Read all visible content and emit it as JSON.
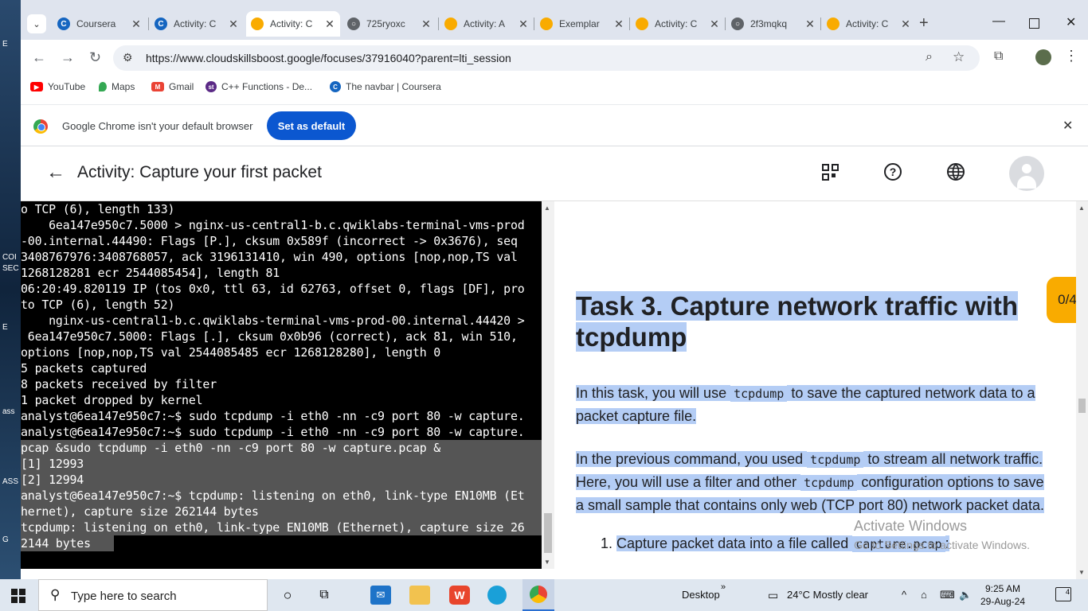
{
  "desktop": {
    "labels": [
      "E",
      "COI",
      "SEC",
      "E",
      "ass",
      "ASS",
      "G"
    ]
  },
  "tabs": [
    {
      "title": "Coursera",
      "fav": "C",
      "color": "#1565c0"
    },
    {
      "title": "Activity: C",
      "fav": "C",
      "color": "#1565c0"
    },
    {
      "title": "Activity: C",
      "fav": "",
      "color": "#f9ab00",
      "active": true
    },
    {
      "title": "725ryoxc",
      "fav": "",
      "color": "#5f6368"
    },
    {
      "title": "Activity: A",
      "fav": "",
      "color": "#f9ab00"
    },
    {
      "title": "Exemplar",
      "fav": "",
      "color": "#f9ab00"
    },
    {
      "title": "Activity: C",
      "fav": "",
      "color": "#f9ab00"
    },
    {
      "title": "2f3mqkq",
      "fav": "",
      "color": "#5f6368"
    },
    {
      "title": "Activity: C",
      "fav": "",
      "color": "#f9ab00"
    }
  ],
  "address": {
    "url": "https://www.cloudskillsboost.google/focuses/37916040?parent=lti_session"
  },
  "bookmarks": [
    {
      "label": "YouTube",
      "color": "#ff0000"
    },
    {
      "label": "Maps",
      "color": "#34a853"
    },
    {
      "label": "Gmail",
      "color": "#ea4335"
    },
    {
      "label": "C++ Functions - De...",
      "color": "#5b2a86"
    },
    {
      "label": "The navbar | Coursera",
      "color": "#1565c0"
    }
  ],
  "infobar": {
    "message": "Google Chrome isn't your default browser",
    "button": "Set as default"
  },
  "lab": {
    "title": "Activity: Capture your first packet",
    "score": "0/4"
  },
  "terminal": {
    "lines": [
      "o TCP (6), length 133)",
      "    6ea147e950c7.5000 > nginx-us-central1-b.c.qwiklabs-terminal-vms-prod",
      "-00.internal.44490: Flags [P.], cksum 0x589f (incorrect -> 0x3676), seq",
      "3408767976:3408768057, ack 3196131410, win 490, options [nop,nop,TS val",
      "1268128281 ecr 2544085454], length 81",
      "06:20:49.820119 IP (tos 0x0, ttl 63, id 62763, offset 0, flags [DF], pro",
      "to TCP (6), length 52)",
      "    nginx-us-central1-b.c.qwiklabs-terminal-vms-prod-00.internal.44420 >",
      " 6ea147e950c7.5000: Flags [.], cksum 0x0b96 (correct), ack 81, win 510,",
      "options [nop,nop,TS val 2544085485 ecr 1268128280], length 0",
      "5 packets captured",
      "8 packets received by filter",
      "1 packet dropped by kernel",
      "analyst@6ea147e950c7:~$ sudo tcpdump -i eth0 -nn -c9 port 80 -w capture.",
      "analyst@6ea147e950c7:~$ sudo tcpdump -i eth0 -nn -c9 port 80 -w capture.",
      "pcap &sudo tcpdump -i eth0 -nn -c9 port 80 -w capture.pcap &",
      "[1] 12993",
      "[2] 12994",
      "analyst@6ea147e950c7:~$ tcpdump: listening on eth0, link-type EN10MB (Et",
      "hernet), capture size 262144 bytes",
      "tcpdump: listening on eth0, link-type EN10MB (Ethernet), capture size 26",
      "2144 bytes"
    ]
  },
  "instructions": {
    "heading": "Task 3. Capture network traffic with tcpdump",
    "p1_a": "In this task, you will use ",
    "p1_code": "tcpdump",
    "p1_b": " to save the captured network data to a packet capture file.",
    "p2_a": "In the previous command, you used ",
    "p2_code1": "tcpdump",
    "p2_b": " to stream all network traffic. Here, you will use a filter and other ",
    "p2_code2": "tcpdump",
    "p2_c": " configuration options to save a small sample that contains only web (TCP port 80) network packet data.",
    "step_num": "1.",
    "step_a": "Capture packet data into a file called ",
    "step_code": "capture.pcap",
    "step_b": ":"
  },
  "watermark": {
    "line1": "Activate Windows",
    "line2": "Go to Settings to activate Windows."
  },
  "taskbar": {
    "search_placeholder": "Type here to search",
    "desktop_label": "Desktop",
    "weather": "24°C  Mostly clear",
    "time": "9:25 AM",
    "date": "29-Aug-24",
    "notifications": "4"
  }
}
